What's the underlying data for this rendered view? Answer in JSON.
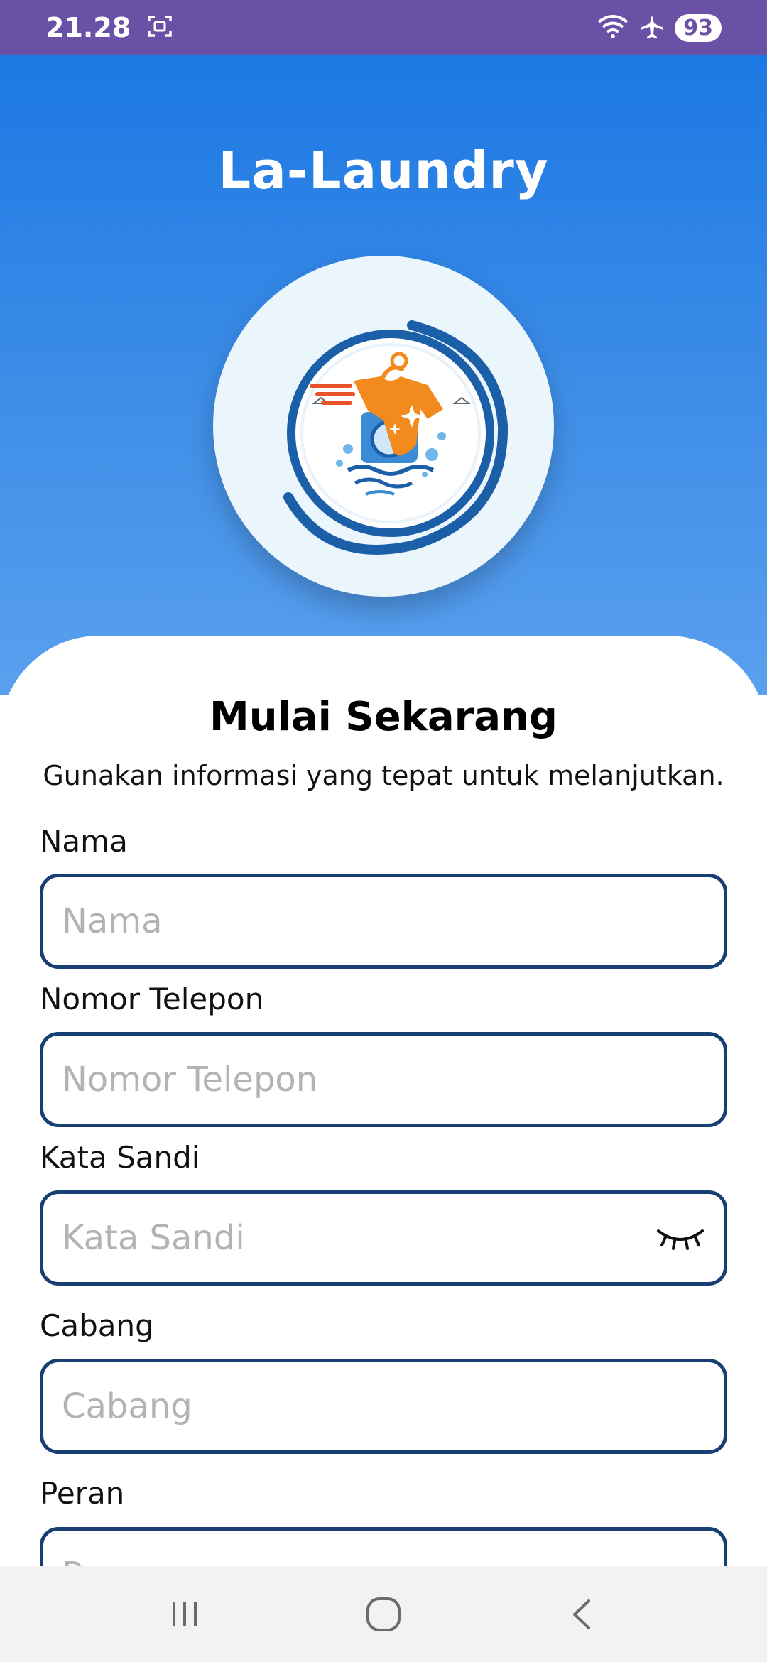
{
  "status_bar": {
    "time": "21.28",
    "battery": "93",
    "icons": [
      "screenshot-icon",
      "wifi-icon",
      "airplane-icon"
    ]
  },
  "app": {
    "title": "La-Laundry"
  },
  "card": {
    "title": "Mulai Sekarang",
    "subtitle": "Gunakan informasi yang tepat untuk melanjutkan."
  },
  "form": {
    "fields": [
      {
        "label": "Nama",
        "placeholder": "Nama",
        "value": ""
      },
      {
        "label": "Nomor Telepon",
        "placeholder": "Nomor Telepon",
        "value": ""
      },
      {
        "label": "Kata Sandi",
        "placeholder": "Kata Sandi",
        "value": ""
      },
      {
        "label": "Cabang",
        "placeholder": "Cabang",
        "value": ""
      },
      {
        "label": "Peran",
        "placeholder": "Peran",
        "value": ""
      }
    ]
  },
  "nav": {
    "icons": [
      "recent-apps-icon",
      "home-icon",
      "back-icon"
    ]
  },
  "colors": {
    "status_bar": "#6a51a6",
    "hero_top": "#1c78e3",
    "field_border": "#173f74",
    "logo_ring": "#1a5fa8",
    "logo_orange": "#f28a1e"
  }
}
